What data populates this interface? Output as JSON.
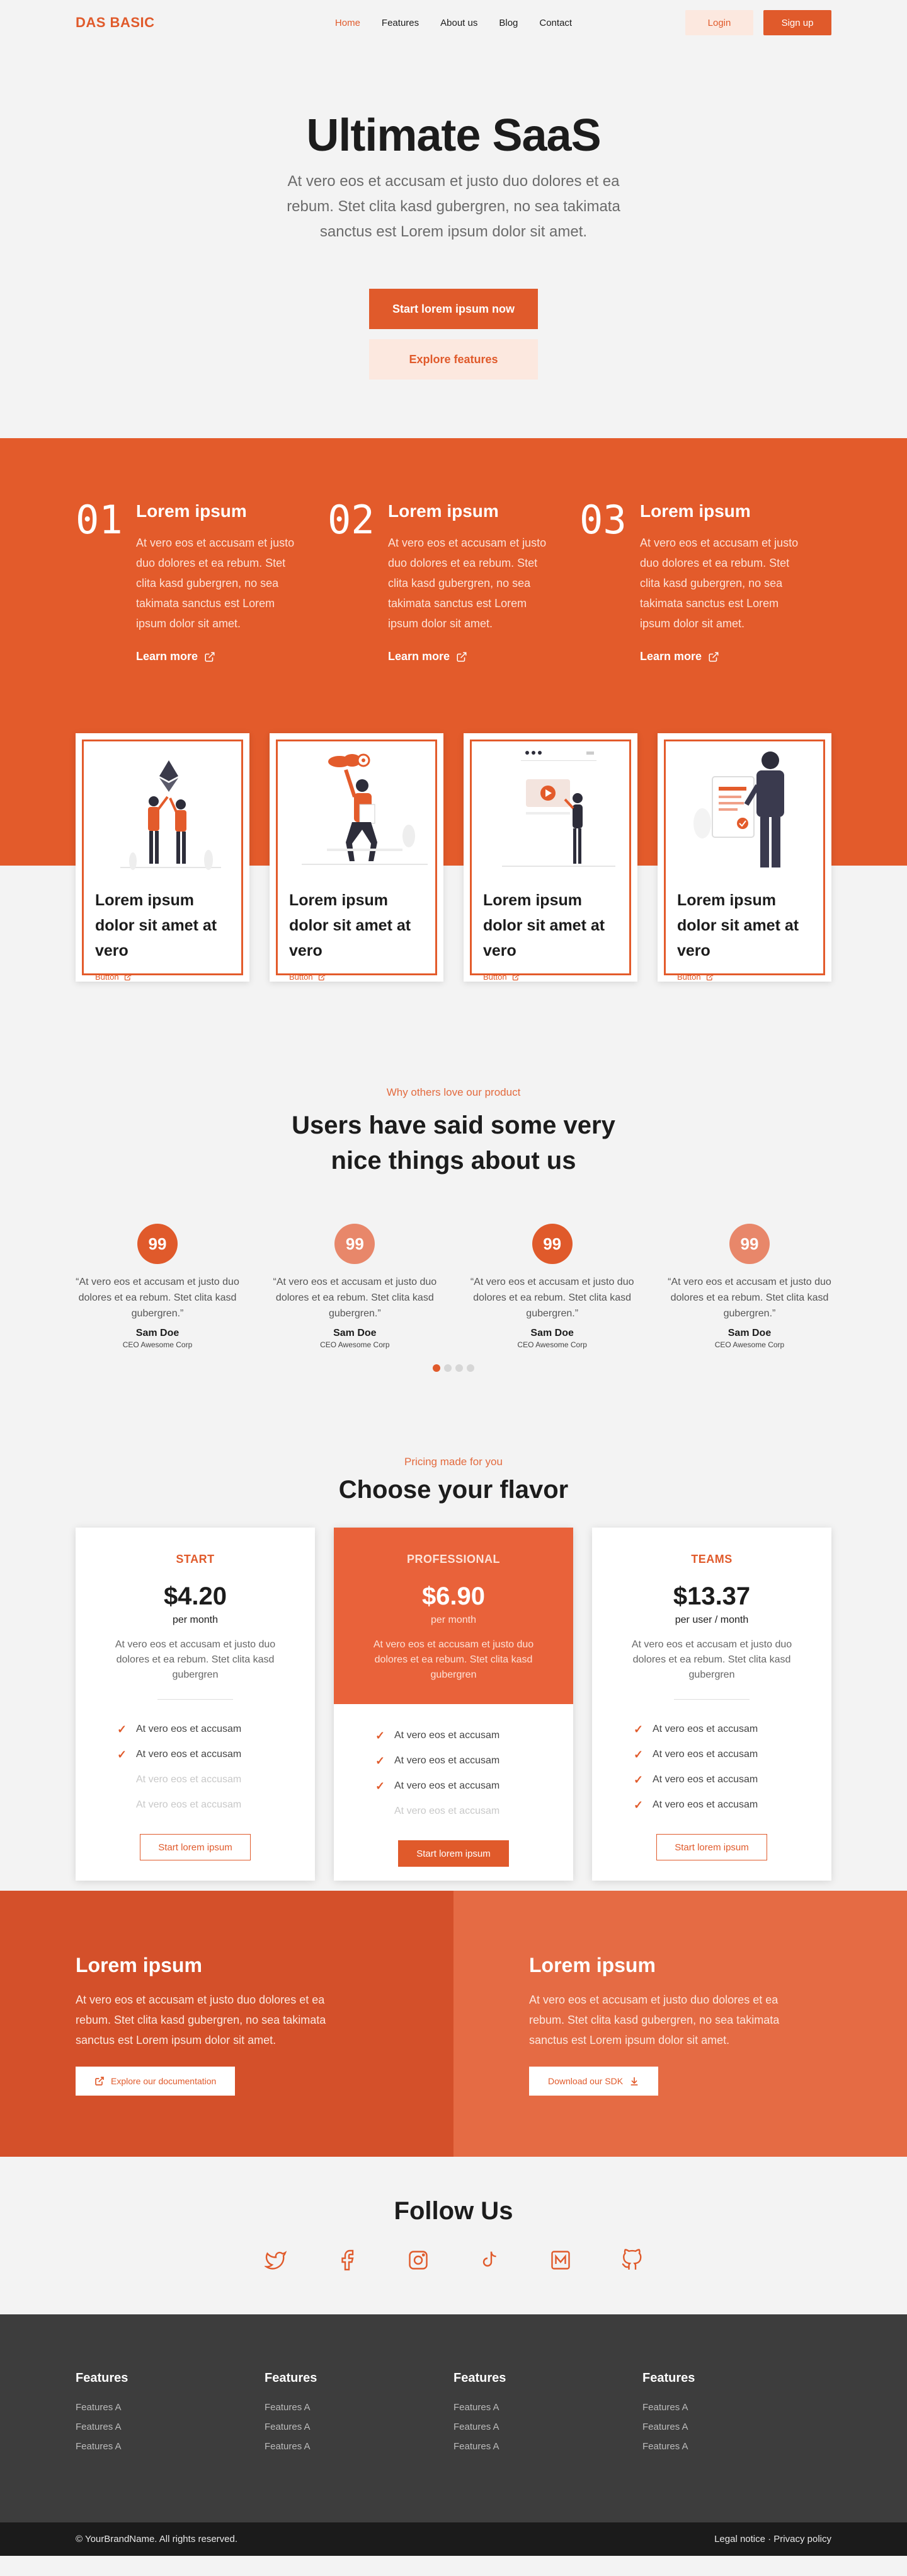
{
  "nav": {
    "brand": "DAS BASIC",
    "items": [
      {
        "label": "Home"
      },
      {
        "label": "Features"
      },
      {
        "label": "About us"
      },
      {
        "label": "Blog"
      },
      {
        "label": "Contact"
      }
    ],
    "login": "Login",
    "signup": "Sign up"
  },
  "hero": {
    "title": "Ultimate SaaS",
    "subtitle": "At vero eos et accusam et justo duo dolores et ea rebum. Stet clita kasd gubergren, no sea takimata sanctus est Lorem ipsum dolor sit amet.",
    "primary_cta": "Start lorem ipsum now",
    "secondary_cta": "Explore features"
  },
  "features": [
    {
      "num": "01",
      "title": "Lorem ipsum",
      "text": "At vero eos et accusam et justo duo dolores et ea rebum. Stet clita kasd gubergren, no sea takimata sanctus est Lorem ipsum dolor sit amet.",
      "link": "Learn more"
    },
    {
      "num": "02",
      "title": "Lorem ipsum",
      "text": "At vero eos et accusam et justo duo dolores et ea rebum. Stet clita kasd gubergren, no sea takimata sanctus est Lorem ipsum dolor sit amet.",
      "link": "Learn more"
    },
    {
      "num": "03",
      "title": "Lorem ipsum",
      "text": "At vero eos et accusam et justo duo dolores et ea rebum. Stet clita kasd gubergren, no sea takimata sanctus est Lorem ipsum dolor sit amet.",
      "link": "Learn more"
    }
  ],
  "cards": [
    {
      "title": "Lorem ipsum dolor sit amet at vero",
      "button": "Button"
    },
    {
      "title": "Lorem ipsum dolor sit amet at vero",
      "button": "Button"
    },
    {
      "title": "Lorem ipsum dolor sit amet at vero",
      "button": "Button"
    },
    {
      "title": "Lorem ipsum dolor sit amet at vero",
      "button": "Button"
    }
  ],
  "testimonials": {
    "eyebrow": "Why others love our product",
    "title": "Users have said some very nice things about us",
    "quote_glyph": "99",
    "items": [
      {
        "quote": "“At vero eos et accusam et justo duo dolores et ea rebum. Stet clita kasd gubergren.”",
        "name": "Sam Doe",
        "role": "CEO Awesome Corp",
        "color": "#e05a2b"
      },
      {
        "quote": "“At vero eos et accusam et justo duo dolores et ea rebum. Stet clita kasd gubergren.”",
        "name": "Sam Doe",
        "role": "CEO Awesome Corp",
        "color": "#e8876a"
      },
      {
        "quote": "“At vero eos et accusam et justo duo dolores et ea rebum. Stet clita kasd gubergren.”",
        "name": "Sam Doe",
        "role": "CEO Awesome Corp",
        "color": "#e05a2b"
      },
      {
        "quote": "“At vero eos et accusam et justo duo dolores et ea rebum. Stet clita kasd gubergren.”",
        "name": "Sam Doe",
        "role": "CEO Awesome Corp",
        "color": "#e8876a"
      }
    ]
  },
  "pricing": {
    "eyebrow": "Pricing made for you",
    "title": "Choose your flavor",
    "plans": [
      {
        "name": "START",
        "price": "$4.20",
        "per": "per month",
        "desc": "At vero eos et accusam et justo duo dolores et ea rebum. Stet clita kasd gubergren",
        "features": [
          "At vero eos et accusam",
          "At vero eos et accusam",
          "At vero eos et accusam",
          "At vero eos et accusam"
        ],
        "button": "Start lorem ipsum"
      },
      {
        "name": "PROFESSIONAL",
        "price": "$6.90",
        "per": "per month",
        "desc": "At vero eos et accusam et justo duo dolores et ea rebum. Stet clita kasd gubergren",
        "features": [
          "At vero eos et accusam",
          "At vero eos et accusam",
          "At vero eos et accusam",
          "At vero eos et accusam"
        ],
        "button": "Start lorem ipsum"
      },
      {
        "name": "TEAMS",
        "price": "$13.37",
        "per": "per user / month",
        "desc": "At vero eos et accusam et justo duo dolores et ea rebum. Stet clita kasd gubergren",
        "features": [
          "At vero eos et accusam",
          "At vero eos et accusam",
          "At vero eos et accusam",
          "At vero eos et accusam"
        ],
        "button": "Start lorem ipsum"
      }
    ]
  },
  "split": {
    "left": {
      "title": "Lorem ipsum",
      "text": "At vero eos et accusam et justo duo dolores et ea rebum. Stet clita kasd gubergren, no sea takimata sanctus est Lorem ipsum dolor sit amet.",
      "button": "Explore our documentation"
    },
    "right": {
      "title": "Lorem ipsum",
      "text": "At vero eos et accusam et justo duo dolores et ea rebum. Stet clita kasd gubergren, no sea takimata sanctus est Lorem ipsum dolor sit amet.",
      "button": "Download our SDK"
    }
  },
  "follow": {
    "title": "Follow Us",
    "icons": [
      "twitter-icon",
      "facebook-icon",
      "instagram-icon",
      "tiktok-icon",
      "medium-icon",
      "github-icon"
    ]
  },
  "footer": {
    "columns": [
      {
        "title": "Features",
        "links": [
          "Features A",
          "Features A",
          "Features A"
        ]
      },
      {
        "title": "Features",
        "links": [
          "Features A",
          "Features A",
          "Features A"
        ]
      },
      {
        "title": "Features",
        "links": [
          "Features A",
          "Features A",
          "Features A"
        ]
      },
      {
        "title": "Features",
        "links": [
          "Features A",
          "Features A",
          "Features A"
        ]
      }
    ],
    "copyright": "© YourBrandName. All rights reserved.",
    "legal": "Legal notice · Privacy policy"
  },
  "colors": {
    "accent": "#e05a2b",
    "band": "#e35b2b",
    "soft": "#fce8df",
    "footer": "#3d3d3d"
  }
}
